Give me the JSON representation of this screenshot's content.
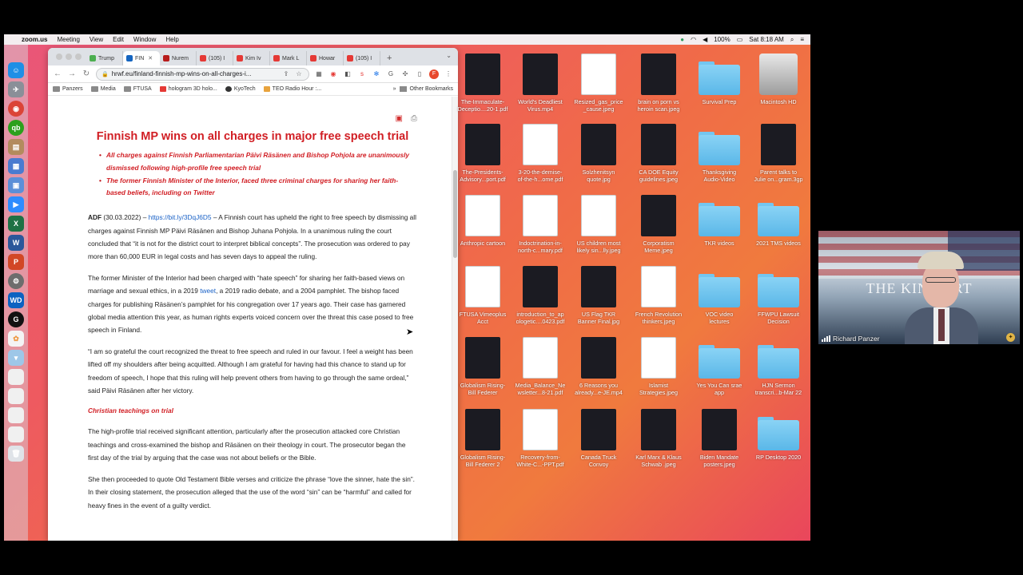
{
  "menubar": {
    "app": "zoom.us",
    "items": [
      "Meeting",
      "View",
      "Edit",
      "Window",
      "Help"
    ],
    "battery": "100%",
    "clock": "Sat 8:18 AM"
  },
  "browser": {
    "tabs": [
      {
        "label": "Trump",
        "color": "#4caf50"
      },
      {
        "label": "FIN",
        "color": "#1565c0",
        "active": true
      },
      {
        "label": "Nurem",
        "color": "#b71c1c"
      },
      {
        "label": "(105) I",
        "color": "#e53935"
      },
      {
        "label": "Kim Iv",
        "color": "#e53935"
      },
      {
        "label": "Mark L",
        "color": "#e53935"
      },
      {
        "label": "Howar",
        "color": "#e53935"
      },
      {
        "label": "(105) I",
        "color": "#e53935"
      }
    ],
    "url": "hrwf.eu/finland-finnish-mp-wins-on-all-charges-i...",
    "profile_initial": "F",
    "bookmarks": [
      "Panzers",
      "Media",
      "FTUSA",
      "hologram 3D holo...",
      "KyoTech",
      "TEO Radio Hour :..."
    ],
    "other_bookmarks": "Other Bookmarks"
  },
  "article": {
    "title": "Finnish MP wins on all charges in major free speech trial",
    "bullets": [
      "All charges against Finnish Parliamentarian Päivi Räsänen and Bishop Pohjola are unanimously dismissed following high-profile free speech trial",
      "The former Finnish Minister of the Interior, faced three criminal charges for sharing her faith-based beliefs, including on Twitter"
    ],
    "p1_source": "ADF",
    "p1_date": " (30.03.2022) – ",
    "p1_link": "https://bit.ly/3DqJ6D5",
    "p1_text": " – A Finnish court has upheld the right to free speech by dismissing all charges against Finnish MP Päivi Räsänen and Bishop Juhana Pohjola. In a unanimous ruling the court concluded that “it is not for the district court to interpret biblical concepts”. The prosecution was ordered to pay more than 60,000 EUR in legal costs and has seven days to appeal the ruling.",
    "p2_a": "The former Minister of the Interior had been charged with “hate speech” for sharing her faith-based views on marriage and sexual ethics, in a 2019 ",
    "p2_link": "tweet",
    "p2_b": ", a 2019 radio debate, and a 2004 pamphlet. The bishop faced charges for publishing Räsänen’s pamphlet for his congregation over 17 years ago. Their case has garnered global media attention this year, as human rights experts voiced concern over the threat this case posed to free speech in Finland.",
    "p3": "“I am so grateful the court recognized the threat to free speech and ruled in our favour. I feel a weight has been lifted off my shoulders after being acquitted. Although I am grateful for having had this chance to stand up for freedom of speech, I hope that this ruling will help prevent others from having to go through the same ordeal,” said Päivi Räsänen after her victory.",
    "subhead": "Christian teachings on trial",
    "p4": "The high-profile trial received significant attention, particularly after the prosecution attacked core Christian teachings and cross-examined the bishop and Räsänen on their theology in court. The prosecutor began the first day of the trial by arguing that the case was not about beliefs or the Bible.",
    "p5": "She then proceeded to quote Old Testament Bible verses and criticize the phrase “love the sinner, hate the sin”. In their closing statement, the prosecution alleged that the use of the word “sin” can be “harmful” and called for heavy fines in the event of a guilty verdict."
  },
  "desktop": [
    {
      "label1": "The-Immaculate-",
      "label2": "Deceptio....20-1.pdf",
      "kind": "dark"
    },
    {
      "label1": "World's Deadliest",
      "label2": "Virus.mp4",
      "kind": "dark"
    },
    {
      "label1": "Resized_gas_price",
      "label2": "_cause.jpeg",
      "kind": "doc"
    },
    {
      "label1": "brain on porn vs",
      "label2": "heroin scan.jpeg",
      "kind": "dark"
    },
    {
      "label1": "Survival Prep",
      "label2": "",
      "kind": "folder"
    },
    {
      "label1": "Macintosh HD",
      "label2": "",
      "kind": "disk"
    },
    {
      "label1": "The-Presidents-",
      "label2": "Advisory...port.pdf",
      "kind": "dark"
    },
    {
      "label1": "3-20-the-demise-",
      "label2": "of-the-h...ome.pdf",
      "kind": "doc"
    },
    {
      "label1": "Solzhenitsyn",
      "label2": "quote.jpg",
      "kind": "dark"
    },
    {
      "label1": "CA DOE Equity",
      "label2": "guidelines.jpeg",
      "kind": "dark"
    },
    {
      "label1": "Thanksgiving",
      "label2": "Audio-Video",
      "kind": "folder"
    },
    {
      "label1": "Parent talks to",
      "label2": "Julie on...gram.3gp",
      "kind": "dark"
    },
    {
      "label1": "Anthropic cartoon",
      "label2": "",
      "kind": "doc"
    },
    {
      "label1": "Indoctrination-in-",
      "label2": "north-c...mary.pdf",
      "kind": "doc"
    },
    {
      "label1": "US children most",
      "label2": "likely sin...lly.jpeg",
      "kind": "doc"
    },
    {
      "label1": "Corporatism",
      "label2": "Meme.jpeg",
      "kind": "dark"
    },
    {
      "label1": "TKR videos",
      "label2": "",
      "kind": "folder"
    },
    {
      "label1": "2021 TMS videos",
      "label2": "",
      "kind": "folder"
    },
    {
      "label1": "FTUSA Vimeoplus",
      "label2": "Acct",
      "kind": "doc"
    },
    {
      "label1": "introduction_to_ap",
      "label2": "ologetic....0423.pdf",
      "kind": "dark"
    },
    {
      "label1": "US Flag TKR",
      "label2": "Banner Final.jpg",
      "kind": "dark"
    },
    {
      "label1": "French Revolution",
      "label2": "thinkers.jpeg",
      "kind": "doc"
    },
    {
      "label1": "VOC video",
      "label2": "lectures",
      "kind": "folder"
    },
    {
      "label1": "FFWPU Lawsuit",
      "label2": "Decision",
      "kind": "folder"
    },
    {
      "label1": "Globalism Rising-",
      "label2": "Bill Federer",
      "kind": "dark"
    },
    {
      "label1": "Media_Balance_Ne",
      "label2": "wsletter...8-21.pdf",
      "kind": "doc"
    },
    {
      "label1": "6 Reasons you",
      "label2": "already...e-JE.mp4",
      "kind": "dark"
    },
    {
      "label1": "Islamist",
      "label2": "Strategies.jpeg",
      "kind": "doc"
    },
    {
      "label1": "Yes You Can srae",
      "label2": "app",
      "kind": "folder"
    },
    {
      "label1": "HJN Sermon",
      "label2": "transcri...b-Mar 22",
      "kind": "folder"
    },
    {
      "label1": "Globalism Rising-",
      "label2": "Bill Federer 2",
      "kind": "dark"
    },
    {
      "label1": "Recovery-from-",
      "label2": "White-C...-PPT.pdf",
      "kind": "doc"
    },
    {
      "label1": "Canada Truck",
      "label2": "Convoy",
      "kind": "dark"
    },
    {
      "label1": "Karl Marx & Klaus",
      "label2": "Schwab .jpeg",
      "kind": "dark"
    },
    {
      "label1": "Biden Mandate",
      "label2": "posters.jpeg",
      "kind": "dark"
    },
    {
      "label1": "RP Desktop 2020",
      "label2": "",
      "kind": "folder"
    }
  ],
  "video": {
    "banner": "THE KIN     PORT",
    "participant": "Richard Panzer"
  }
}
